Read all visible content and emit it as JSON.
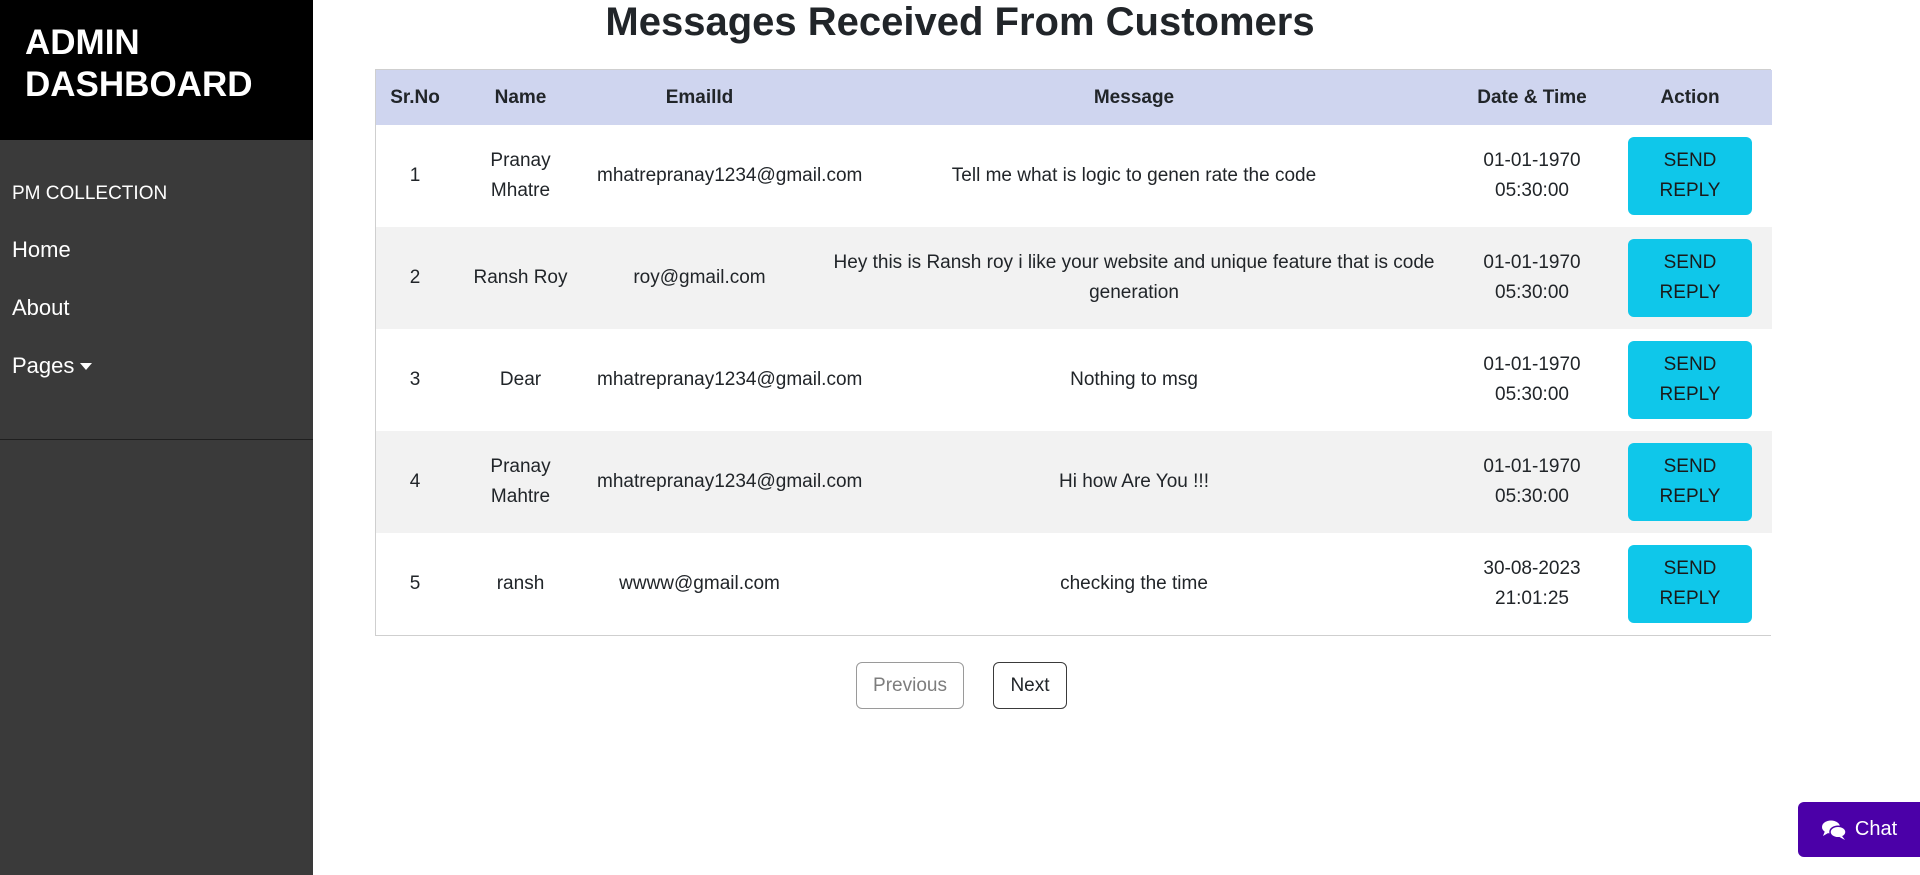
{
  "sidebar": {
    "brand_line1": "ADMIN",
    "brand_line2": "DASHBOARD",
    "collection": "PM COLLECTION",
    "nav": {
      "home": "Home",
      "about": "About",
      "pages": "Pages"
    }
  },
  "main": {
    "title": "Messages Received From Customers",
    "table": {
      "headers": [
        "Sr.No",
        "Name",
        "EmailId",
        "Message",
        "Date & Time",
        "Action"
      ],
      "rows": [
        {
          "sr": "1",
          "name": "Pranay Mhatre",
          "email": "mhatrepranay1234@gmail.com",
          "message": "Tell me what is logic to genen rate the code",
          "date": "01-01-1970",
          "time": "05:30:00"
        },
        {
          "sr": "2",
          "name": "Ransh Roy",
          "email": "roy@gmail.com",
          "message": "Hey this is Ransh roy i like your website and unique feature that is code generation",
          "date": "01-01-1970",
          "time": "05:30:00"
        },
        {
          "sr": "3",
          "name": "Dear",
          "email": "mhatrepranay1234@gmail.com",
          "message": "Nothing to msg",
          "date": "01-01-1970",
          "time": "05:30:00"
        },
        {
          "sr": "4",
          "name": "Pranay Mahtre",
          "email": "mhatrepranay1234@gmail.com",
          "message": "Hi how Are You !!!",
          "date": "01-01-1970",
          "time": "05:30:00"
        },
        {
          "sr": "5",
          "name": "ransh",
          "email": "wwww@gmail.com",
          "message": "checking the time",
          "date": "30-08-2023",
          "time": "21:01:25"
        }
      ],
      "action_line1": "SEND",
      "action_line2": "REPLY"
    },
    "pagination": {
      "previous": "Previous",
      "next": "Next"
    }
  },
  "chat": {
    "label": "Chat",
    "icon": "comments-icon"
  },
  "colors": {
    "sidebar_bg": "#3a3a3a",
    "brand_bg": "#000000",
    "table_header_bg": "#cfd5ef",
    "reply_button": "#0fc7ea",
    "chat_button": "#4b00a8"
  }
}
